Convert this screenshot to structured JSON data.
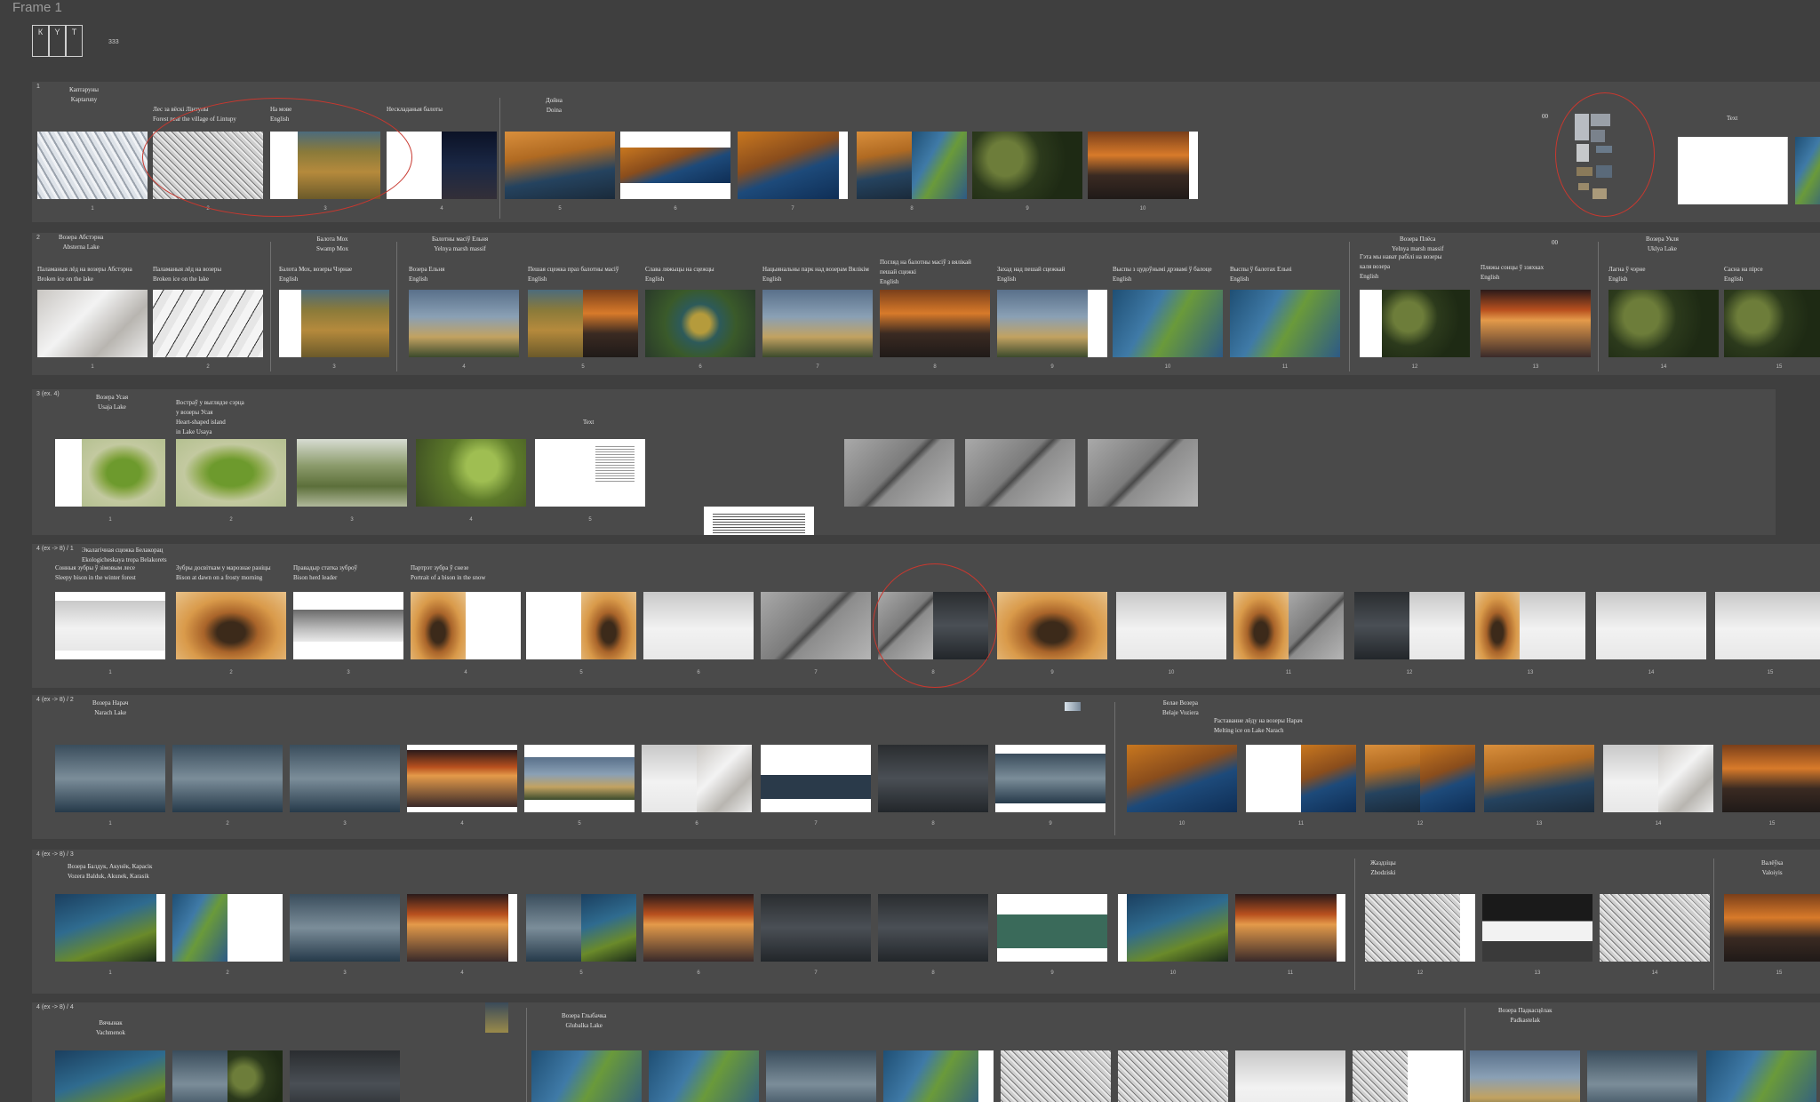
{
  "frame_title": "Frame 1",
  "legend": {
    "letters": [
      "К",
      "Y",
      "Т"
    ],
    "count": "333"
  },
  "accent_color": "#c8382f",
  "sections": [
    {
      "label": "1",
      "captions": [
        "Каптаруны\nKaptaruny",
        "Лес за вёскі Лiнтупы\nForest near the village of Lintupy",
        "На мове\nEnglish",
        "Нескладаныя балоты",
        "Дойна\nDoina",
        "00",
        "Text"
      ],
      "numbers": [
        "1",
        "2",
        "3",
        "4",
        "5",
        "6",
        "7",
        "8",
        "9",
        "10"
      ]
    },
    {
      "label": "2",
      "captions": [
        "Возера Абстэрна\nAbsterna Lake",
        "Паламаныя лёд на возеры Абстэрна\nBroken ice on the lake",
        "Паламаныя лёд на возеры\nBroken ice on the lake",
        "Балота Мох\nSwamp Mox",
        "Балота Мох, возеры Чэрнае\nEnglish",
        "Балотны масіў Ельня\nYelnya marsh massif",
        "Возера Ельня\nEnglish",
        "Пешая сцежка праз балотны масіў\nEnglish",
        "Слава ляжыцы на сцежцы\nEnglish",
        "Нацыянальны парк над возерам Вялікім\nEnglish",
        "Погляд на балотны масіў з вялікай\nпешай сцежкі\nEnglish",
        "Захад над пешай сцежкай\nEnglish",
        "Выспы з цудоўнымі дрэвамі ў балоце\nEnglish",
        "Выспы ў балотах Ельні\nEnglish",
        "Возера Плёса\nYelnya marsh massif",
        "Гэта мы нават рабілі на возеры\nкаля возера\nEnglish",
        "Пляжы сонцы ў ззяхках\nEnglish",
        "00",
        "Возера Укля\nUklya Lake",
        "Лагна ў чэрне\nEnglish",
        "Сасна на пірсе\nEnglish"
      ],
      "numbers": [
        "1",
        "2",
        "3",
        "4",
        "5",
        "6",
        "7",
        "8",
        "9",
        "10",
        "11",
        "12",
        "13",
        "14",
        "15"
      ]
    },
    {
      "label": "3 (ex. 4)",
      "captions": [
        "Возера Усая\nUsaja Lake",
        "Востраў у выглядзе сэрца\nу возеры Усая\nHeart-shaped island\nin Lake Usaya",
        "Text"
      ],
      "numbers": [
        "1",
        "2",
        "3",
        "4",
        "5"
      ]
    },
    {
      "label": "4 (ex -> 8) / 1",
      "captions": [
        "Экалагічная сцежка Белакорац\nEkologicheskaya tropa Belakorets",
        "Сонныя зубры ў зімовым лесе\nSleepy bison in the winter forest",
        "Зубры досвіткам у марознае раніцы\nBison at dawn on a frosty morning",
        "Правадыр статка зуброў\nBison herd leader",
        "Партрэт зубра ў снезе\nPortrait of a bison in the snow"
      ],
      "numbers": [
        "1",
        "2",
        "3",
        "4",
        "5",
        "6",
        "7",
        "8",
        "9",
        "10",
        "11",
        "12",
        "13",
        "14",
        "15"
      ]
    },
    {
      "label": "4 (ex -> 8) / 2",
      "captions": [
        "Возера Нарач\nNarach Lake",
        "Белае Возера\nBelaje Voziera",
        "Раставанне лёду на возеры Нарач\nMelting ice on Lake Narach"
      ],
      "numbers": [
        "1",
        "2",
        "3",
        "4",
        "5",
        "6",
        "7",
        "8",
        "9",
        "10",
        "11",
        "12",
        "13",
        "14",
        "15"
      ]
    },
    {
      "label": "4 (ex -> 8) / 3",
      "captions": [
        "Возера Балдук, Акунёк, Карасік\nVozera Balduk, Akunek, Karasik",
        "Жаздзіцы\nZhodziski",
        "Валёўка\nValoiyis"
      ],
      "numbers": [
        "1",
        "2",
        "3",
        "4",
        "5",
        "6",
        "7",
        "8",
        "9",
        "10",
        "11",
        "12",
        "13",
        "14",
        "15"
      ]
    },
    {
      "label": "4 (ex -> 8) / 4",
      "captions": [
        "Вячынак\nVachmenok",
        "Возера Глыбачка\nGlubalka Lake",
        "Возера Падкасцёлак\nPadkastelak"
      ]
    }
  ]
}
